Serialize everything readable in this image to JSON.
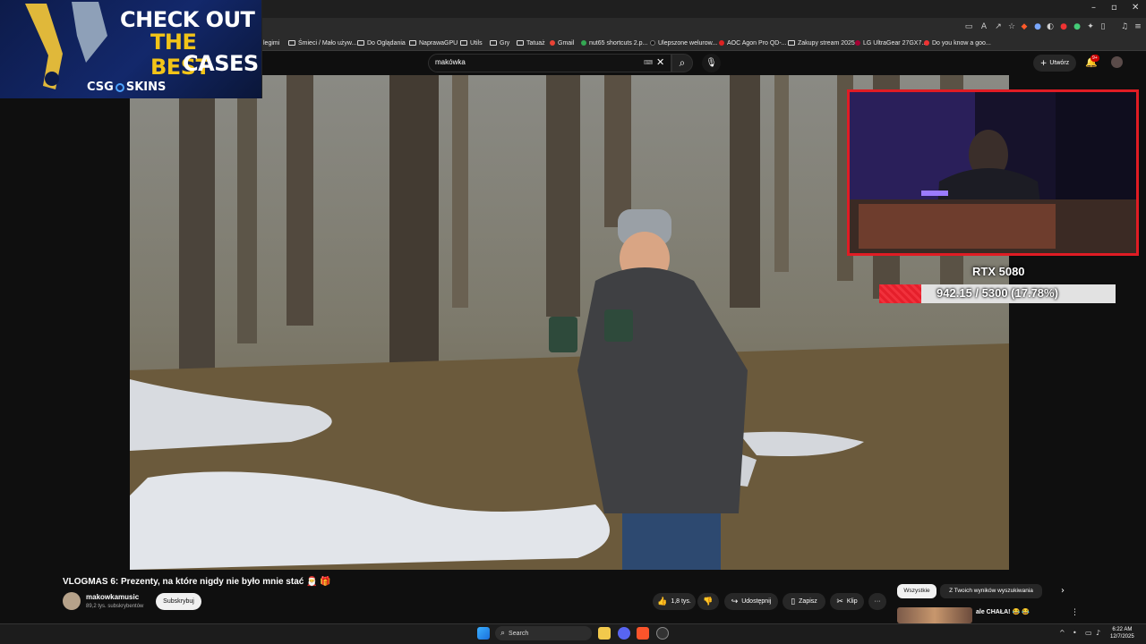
{
  "browser": {
    "window_controls": [
      "–",
      "▫",
      "✕"
    ],
    "bookmarks": [
      {
        "label": "legimi",
        "icon": "folder-icon"
      },
      {
        "label": "Śmieci / Mało używ...",
        "icon": "folder-icon"
      },
      {
        "label": "Do Oglądania",
        "icon": "folder-icon"
      },
      {
        "label": "NaprawaGPU",
        "icon": "folder-icon"
      },
      {
        "label": "Utils",
        "icon": "folder-icon"
      },
      {
        "label": "Gry",
        "icon": "folder-icon"
      },
      {
        "label": "Tatuaż",
        "icon": "folder-icon"
      },
      {
        "label": "Gmail",
        "icon": "gmail-icon"
      },
      {
        "label": "nut65 shortcuts 2.p...",
        "icon": "google-icon"
      },
      {
        "label": "Ulepszone welurow...",
        "icon": "site-icon"
      },
      {
        "label": "AOC Agon Pro QD-...",
        "icon": "aoc-icon"
      },
      {
        "label": "Zakupy stream 2025",
        "icon": "folder-icon"
      },
      {
        "label": "LG UltraGear 27GX7...",
        "icon": "lg-icon"
      },
      {
        "label": "Do you know a goo...",
        "icon": "site-icon"
      }
    ]
  },
  "youtube": {
    "search": {
      "value": "makówka"
    },
    "create_label": "Utwórz",
    "notifications_badge": "9+",
    "video": {
      "title": "VLOGMAS 6: Prezenty, na które nigdy nie było mnie stać 🎅 🎁",
      "channel_name": "makowkamusic",
      "subscribers": "89,2 tys. subskrybentów",
      "subscribe_label": "Subskrybuj",
      "likes": "1,8 tys.",
      "share_label": "Udostępnij",
      "save_label": "Zapisz",
      "clip_label": "Klip",
      "more_label": "···"
    },
    "chips": {
      "all": "Wszystkie",
      "results": "Z Twoich wyników wyszukiwania"
    },
    "recommendation": {
      "title": "ale CHAŁA! 😂 😂",
      "menu": "⋮"
    }
  },
  "ad": {
    "line1": "CHECK OUT",
    "line2": "THE BEST",
    "line3": "CASES",
    "brand_left": "CSG",
    "brand_right": "SKINS"
  },
  "overlay": {
    "gpu_name": "RTX 5080",
    "progress_text": "942.15 / 5300 (17.78%)",
    "progress_fraction": 0.1778,
    "accent_color": "#e51f2b"
  },
  "taskbar": {
    "search_label": "Search",
    "time": "6:22 AM",
    "date": "12/7/2025"
  }
}
